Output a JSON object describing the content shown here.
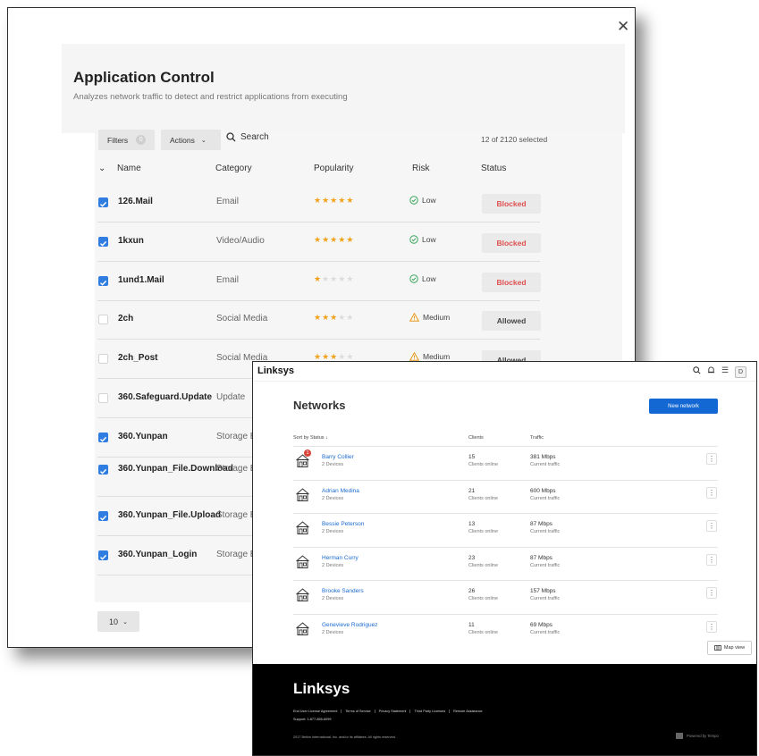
{
  "app_control": {
    "title": "Application Control",
    "subtitle": "Analyzes network traffic to detect and restrict applications from executing",
    "toolbar": {
      "filters": "Filters",
      "filters_count": "0",
      "actions": "Actions",
      "search": "Search",
      "selected": "12 of 2120 selected"
    },
    "columns": {
      "name": "Name",
      "category": "Category",
      "popularity": "Popularity",
      "risk": "Risk",
      "status": "Status"
    },
    "rows": [
      {
        "name": "126.Mail",
        "category": "Email",
        "stars": 5,
        "risk": "Low",
        "status": "Blocked",
        "checked": true
      },
      {
        "name": "1kxun",
        "category": "Video/Audio",
        "stars": 5,
        "risk": "Low",
        "status": "Blocked",
        "checked": true
      },
      {
        "name": "1und1.Mail",
        "category": "Email",
        "stars": 1,
        "risk": "Low",
        "status": "Blocked",
        "checked": true
      },
      {
        "name": "2ch",
        "category": "Social Media",
        "stars": 3,
        "risk": "Medium",
        "status": "Allowed",
        "checked": false
      },
      {
        "name": "2ch_Post",
        "category": "Social Media",
        "stars": 3,
        "risk": "Medium",
        "status": "Allowed",
        "checked": false
      },
      {
        "name": "360.Safeguard.Update",
        "category": "Update",
        "checked": false
      },
      {
        "name": "360.Yunpan",
        "category": "Storage B",
        "checked": true
      },
      {
        "name": "360.Yunpan_File.Download",
        "category": "Storage B",
        "checked": true
      },
      {
        "name": "360.Yunpan_File.Upload",
        "category": "Storage B",
        "checked": true
      },
      {
        "name": "360.Yunpan_Login",
        "category": "Storage B",
        "checked": true
      }
    ],
    "page_size": "10"
  },
  "linksys": {
    "brand": "Linksys",
    "title": "Networks",
    "new_network": "New network",
    "user_initial": "D",
    "list_headers": {
      "sort": "Sort by Status ↓",
      "clients": "Clients",
      "traffic": "Traffic"
    },
    "networks": [
      {
        "name": "Barry Collier",
        "devices": "2 Devices",
        "clients": "15",
        "clients_label": "Clients online",
        "traffic": "381 Mbps",
        "traffic_label": "Current traffic",
        "alert": "1"
      },
      {
        "name": "Adrian Medina",
        "devices": "2 Devices",
        "clients": "21",
        "clients_label": "Clients online",
        "traffic": "600 Mbps",
        "traffic_label": "Current traffic"
      },
      {
        "name": "Bessie Peterson",
        "devices": "2 Devices",
        "clients": "13",
        "clients_label": "Clients online",
        "traffic": "87 Mbps",
        "traffic_label": "Current traffic"
      },
      {
        "name": "Herman Curry",
        "devices": "2 Devices",
        "clients": "23",
        "clients_label": "Clients online",
        "traffic": "87 Mbps",
        "traffic_label": "Current traffic"
      },
      {
        "name": "Brooke Sanders",
        "devices": "2 Devices",
        "clients": "26",
        "clients_label": "Clients online",
        "traffic": "157 Mbps",
        "traffic_label": "Current traffic"
      },
      {
        "name": "Genevieve Rodriguez",
        "devices": "2 Devices",
        "clients": "11",
        "clients_label": "Clients online",
        "traffic": "69 Mbps",
        "traffic_label": "Current traffic"
      }
    ],
    "map_view": "Map view",
    "footer": {
      "links": [
        "End User License Agreement",
        "Terms of Service",
        "Privacy Statement",
        "Third Party Licenses",
        "Remote Assistance"
      ],
      "support": "Support: 1-877-855-6099",
      "copyright": "2017 Belkin International, Inc. and/or its affiliates. All rights reserved.",
      "powered": "Powered by Tempo"
    }
  },
  "colors": {
    "accent": "#2f7de1",
    "blocked": "#e05050",
    "star": "#f0a21b",
    "linksys_blue": "#1368d4",
    "alert": "#d9463a"
  }
}
